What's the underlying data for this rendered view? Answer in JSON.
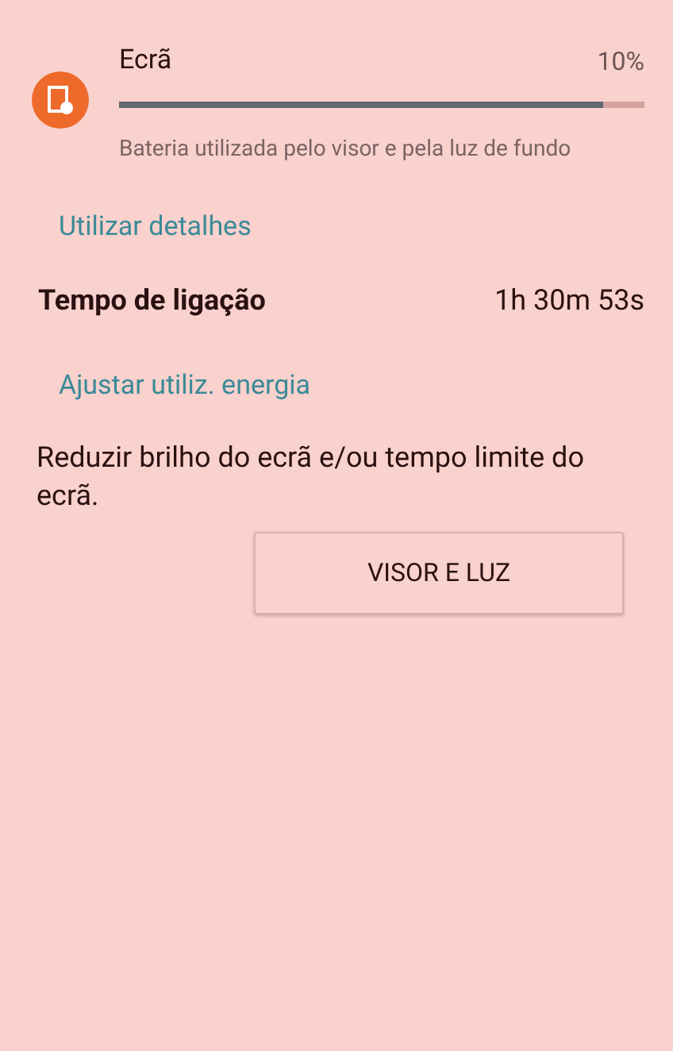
{
  "usage_item": {
    "title": "Ecrã",
    "percent": "10%",
    "level": 0.92,
    "description": "Bateria utilizada pelo visor e pela luz de fundo"
  },
  "details_header": "Utilizar detalhes",
  "details": [
    {
      "label": "Tempo de ligação",
      "value": "1h 30m 53s"
    }
  ],
  "adjust_header": "Ajustar utiliz. energia",
  "tip": "Reduzir brilho do ecrã e/ou tempo limite do ecrã.",
  "action_button": "VISOR E LUZ"
}
